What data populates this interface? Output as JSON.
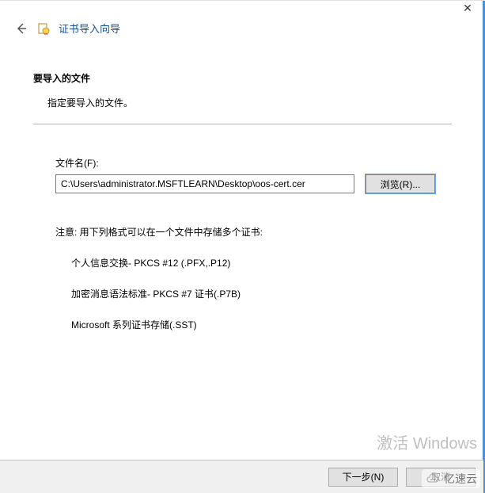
{
  "window": {
    "close_glyph": "✕"
  },
  "header": {
    "title": "证书导入向导"
  },
  "page": {
    "heading": "要导入的文件",
    "lead": "指定要导入的文件。",
    "field_label": "文件名(F):",
    "file_path": "C:\\Users\\administrator.MSFTLEARN\\Desktop\\oos-cert.cer",
    "browse_label": "浏览(R)...",
    "note": "注意: 用下列格式可以在一个文件中存储多个证书:",
    "formats": [
      "个人信息交换- PKCS #12 (.PFX,.P12)",
      "加密消息语法标准- PKCS #7 证书(.P7B)",
      "Microsoft 系列证书存储(.SST)"
    ]
  },
  "footer": {
    "next": "下一步(N)",
    "cancel": "取消"
  },
  "watermark": "激活 Windows",
  "brand": "亿速云"
}
